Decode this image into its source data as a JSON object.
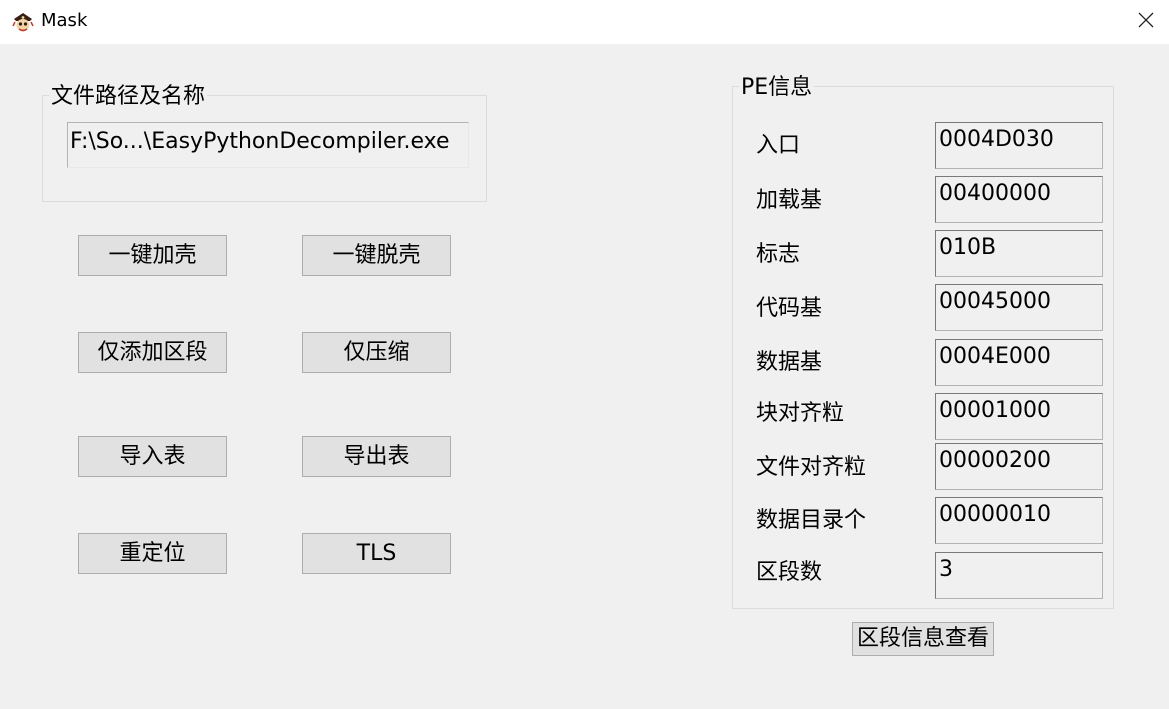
{
  "window": {
    "title": "Mask",
    "icon": "pirate-skull-icon"
  },
  "file_group": {
    "label": "文件路径及名称",
    "path_value": "F:\\So...\\EasyPythonDecompiler.exe"
  },
  "buttons": {
    "pack": "一键加壳",
    "unpack": "一键脱壳",
    "add_section": "仅添加区段",
    "compress": "仅压缩",
    "import_table": "导入表",
    "export_table": "导出表",
    "relocation": "重定位",
    "tls": "TLS"
  },
  "pe_info": {
    "label": "PE信息",
    "rows": [
      {
        "label": "入口",
        "value": "0004D030"
      },
      {
        "label": "加载基",
        "value": "00400000"
      },
      {
        "label": "标志",
        "value": "010B"
      },
      {
        "label": "代码基",
        "value": "00045000"
      },
      {
        "label": "数据基",
        "value": "0004E000"
      },
      {
        "label": "块对齐粒",
        "value": "00001000"
      },
      {
        "label": "文件对齐粒",
        "value": "00000200"
      },
      {
        "label": "数据目录个",
        "value": "00000010"
      },
      {
        "label": "区段数",
        "value": "3"
      }
    ]
  },
  "section_info_button": "区段信息查看"
}
